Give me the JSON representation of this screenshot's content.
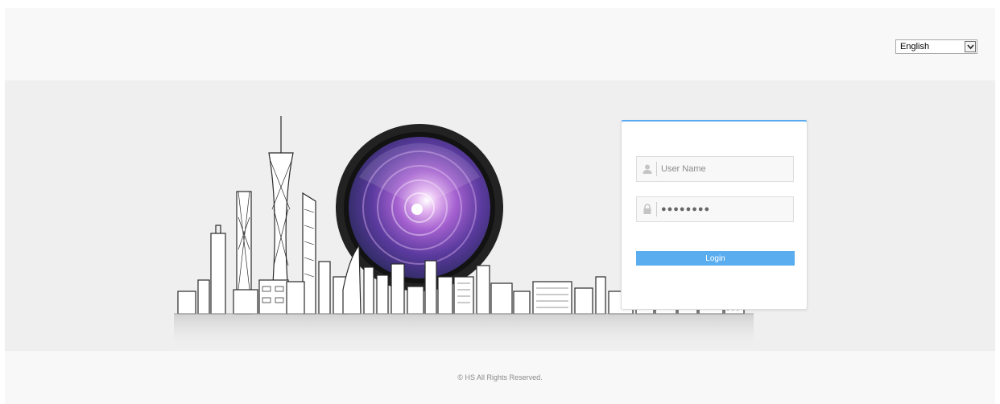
{
  "language": {
    "selected": "English"
  },
  "login": {
    "username_placeholder": "User Name",
    "password_value": "●●●●●●●●",
    "login_label": "Login"
  },
  "footer": {
    "copyright": "© HS  All Rights Reserved."
  },
  "icons": {
    "user": "user-icon",
    "lock": "lock-icon",
    "dropdown": "chevron-down-icon"
  },
  "colors": {
    "accent": "#5aaef0",
    "page_band": "#efefef",
    "header_footer": "#f8f8f8"
  }
}
